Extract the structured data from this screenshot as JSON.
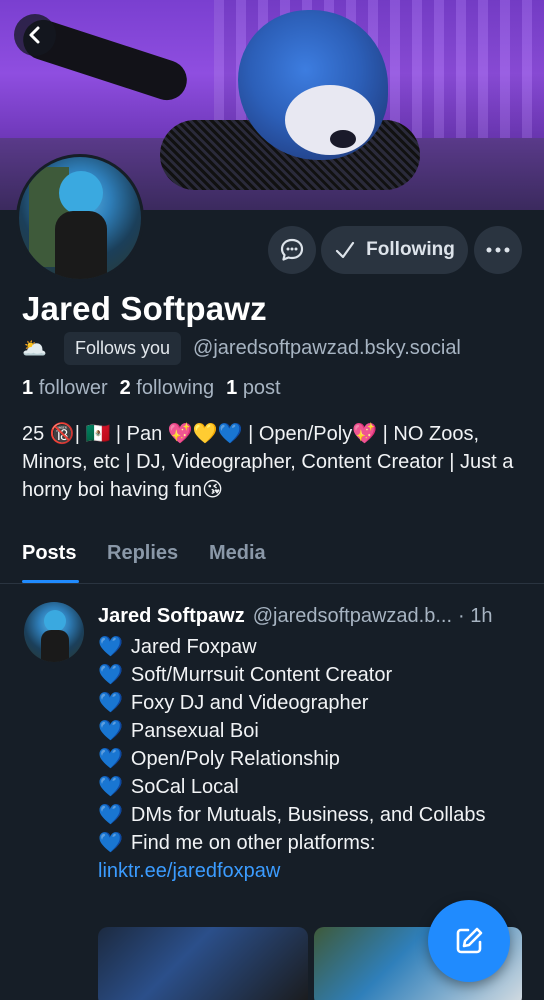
{
  "profile": {
    "display_name": "Jared Softpawz",
    "status_emoji": "🌥️",
    "follows_you_label": "Follows you",
    "handle": "@jaredsoftpawzad.bsky.social",
    "followers_count": "1",
    "followers_label": "follower",
    "following_count": "2",
    "following_label": "following",
    "posts_count": "1",
    "posts_label": "post",
    "bio": "25 🔞| 🇲🇽 | Pan 💖💛💙 | Open/Poly💖 | NO Zoos, Minors, etc | DJ, Videographer, Content Creator | Just a horny boi having fun😘"
  },
  "actions": {
    "following_label": "Following"
  },
  "tabs": [
    {
      "label": "Posts"
    },
    {
      "label": "Replies"
    },
    {
      "label": "Media"
    }
  ],
  "post": {
    "author_name": "Jared Softpawz",
    "author_handle": "@jaredsoftpawzad.b...",
    "time": "· 1h",
    "heart": "💙",
    "lines": [
      "Jared Foxpaw",
      "Soft/Murrsuit Content Creator",
      "Foxy DJ and Videographer",
      "Pansexual Boi",
      "Open/Poly Relationship",
      "SoCal Local",
      "DMs for Mutuals, Business, and Collabs"
    ],
    "link_prefix": "Find me on other platforms: ",
    "link_text": "linktr.ee/jaredfoxpaw"
  },
  "icons": {
    "back": "chevron-left-icon",
    "message": "chat-bubble-icon",
    "following": "check-icon",
    "more": "ellipsis-icon",
    "compose": "compose-icon"
  },
  "colors": {
    "background": "#161e27",
    "accent": "#208bfe",
    "link": "#3b9cff",
    "muted": "#a7b4c2"
  }
}
